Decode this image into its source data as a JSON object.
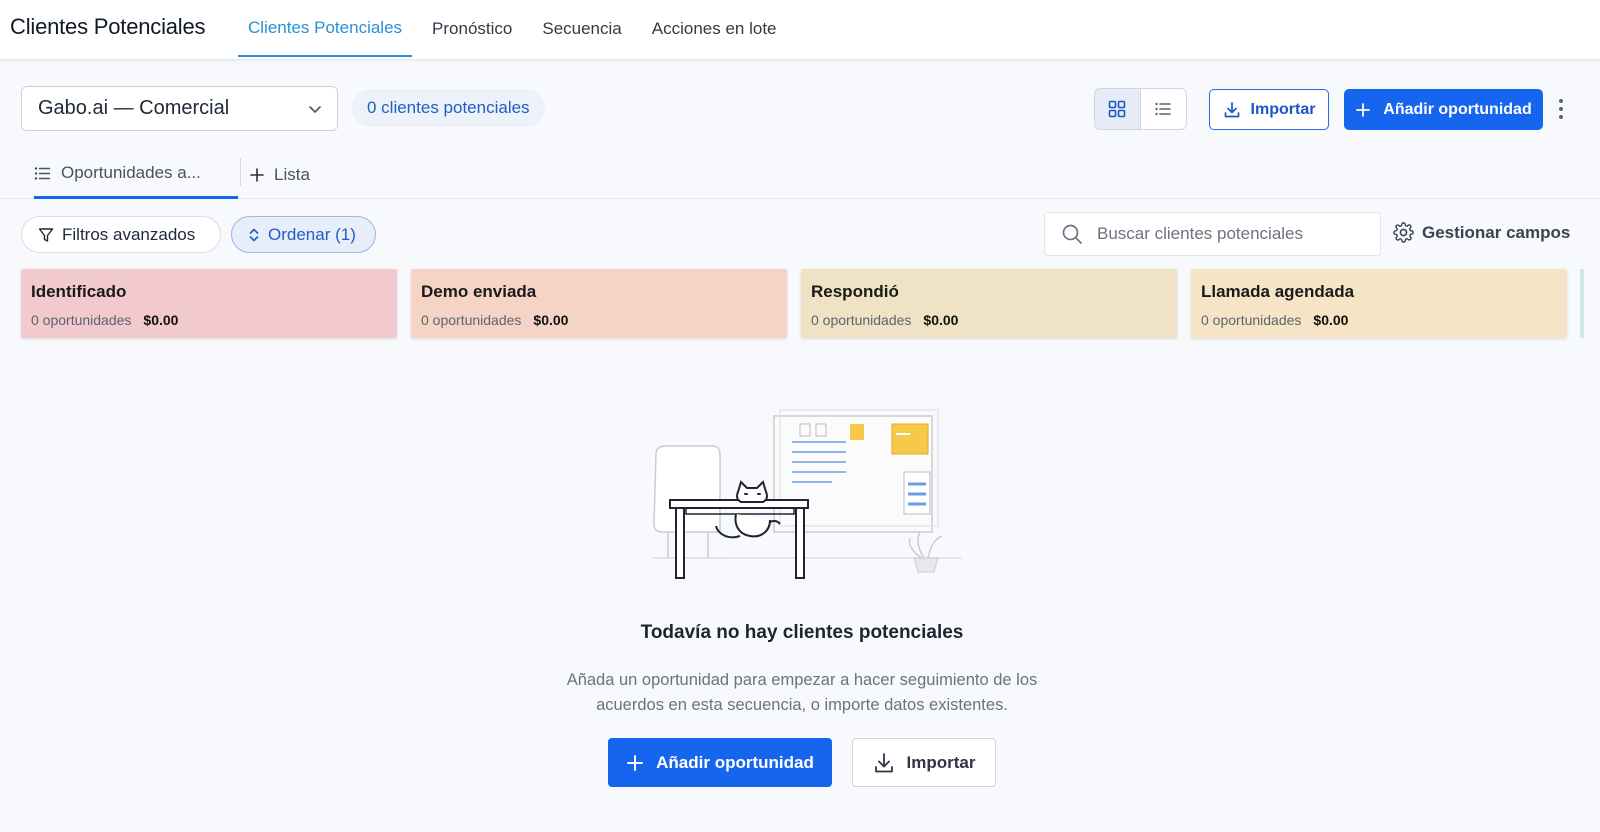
{
  "header": {
    "title": "Clientes Potenciales",
    "tabs": [
      {
        "label": "Clientes Potenciales",
        "active": true
      },
      {
        "label": "Pronóstico"
      },
      {
        "label": "Secuencia"
      },
      {
        "label": "Acciones en lote"
      }
    ]
  },
  "toolbar": {
    "pipeline_select": "Gabo.ai — Comercial",
    "count_pill": "0 clientes potenciales",
    "view_mode": "grid",
    "import_label": "Importar",
    "add_label": "Añadir oportunidad"
  },
  "view_tabs": {
    "active_label": "Oportunidades a...",
    "add_label": "Lista"
  },
  "filters": {
    "advanced_label": "Filtros avanzados",
    "sort_label": "Ordenar (1)",
    "search_placeholder": "Buscar clientes potenciales",
    "manage_fields_label": "Gestionar campos"
  },
  "stages": [
    {
      "name": "Identificado",
      "count_label": "0 oportunidades",
      "amount": "$0.00",
      "color": "#f2c9cd"
    },
    {
      "name": "Demo enviada",
      "count_label": "0 oportunidades",
      "amount": "$0.00",
      "color": "#f5d4c6"
    },
    {
      "name": "Respondió",
      "count_label": "0 oportunidades",
      "amount": "$0.00",
      "color": "#f0e2c4"
    },
    {
      "name": "Llamada agendada",
      "count_label": "0 oportunidades",
      "amount": "$0.00",
      "color": "#f6e4c6"
    }
  ],
  "empty_state": {
    "title": "Todavía no hay clientes potenciales",
    "description": "Añada un oportunidad para empezar a hacer seguimiento de los acuerdos en esta secuencia, o importe datos existentes.",
    "add_label": "Añadir oportunidad",
    "import_label": "Importar"
  },
  "colors": {
    "accent": "#1565ef",
    "tab_active": "#2b8fd6"
  }
}
